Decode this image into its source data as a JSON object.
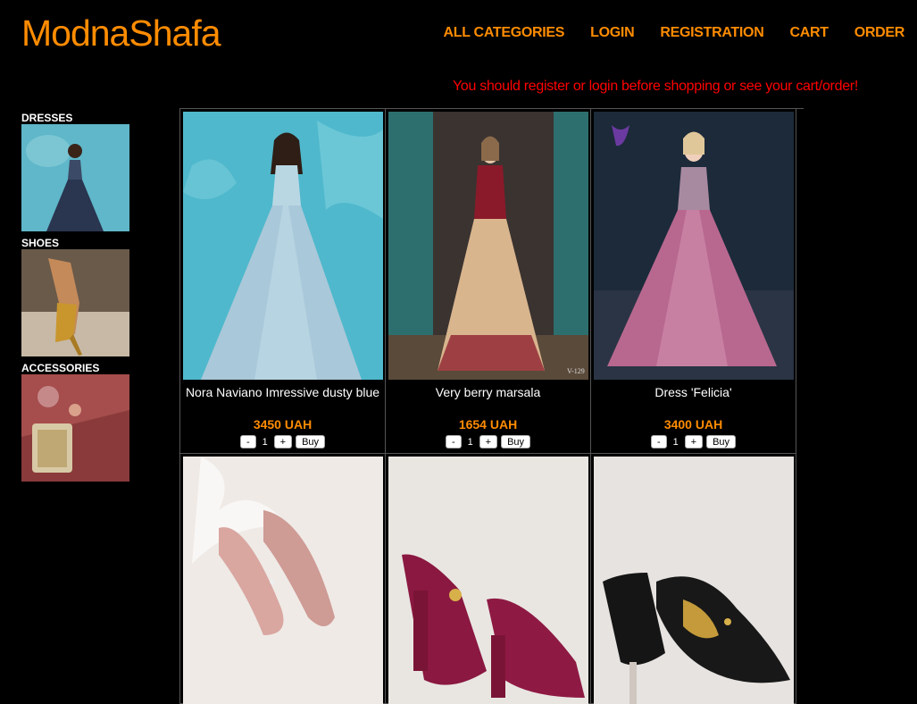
{
  "brand": "ModnaShafa",
  "nav": [
    "ALL CATEGORIES",
    "LOGIN",
    "REGISTRATION",
    "CART",
    "ORDER"
  ],
  "notice": "You should register or login before shopping or see your cart/order!",
  "colors": {
    "accent": "#ff8c00",
    "notice": "#ff0000",
    "background": "#000000"
  },
  "sidebar": [
    {
      "label": "DRESSES"
    },
    {
      "label": "SHOES"
    },
    {
      "label": "ACCESSORIES"
    }
  ],
  "products": [
    {
      "name": "Nora Naviano Imressive dusty blue",
      "price": "3450 UAH",
      "qty": "1"
    },
    {
      "name": "Very berry marsala",
      "price": "1654 UAH",
      "qty": "1"
    },
    {
      "name": "Dress 'Felicia'",
      "price": "3400 UAH",
      "qty": "1"
    }
  ],
  "controls": {
    "minus": "-",
    "plus": "+",
    "buy": "Buy"
  },
  "image_watermarks": {
    "product_2": "V-129"
  }
}
